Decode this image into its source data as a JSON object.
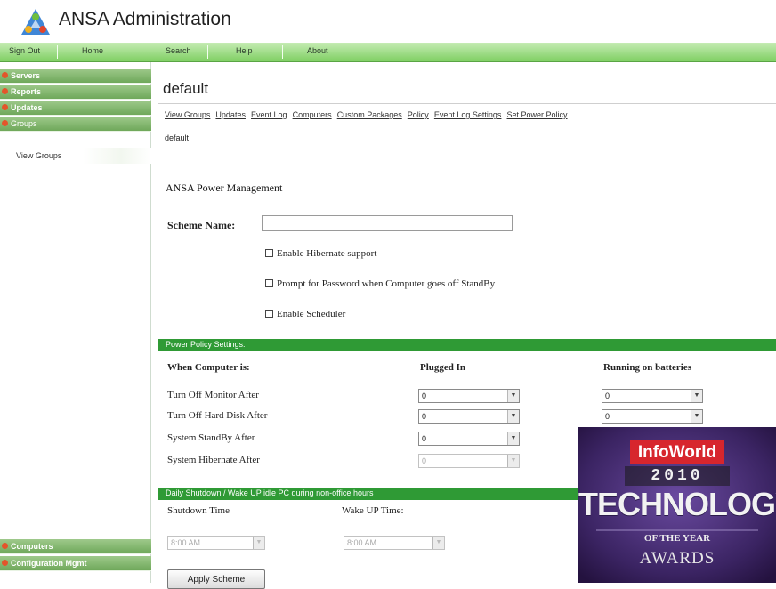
{
  "app": {
    "title": "ANSA Administration"
  },
  "topnav": [
    {
      "label": "Sign Out"
    },
    {
      "label": "Home"
    },
    {
      "label": "Search"
    },
    {
      "label": "Help"
    },
    {
      "label": "About"
    }
  ],
  "sidebar": {
    "items": [
      {
        "label": "Servers"
      },
      {
        "label": "Reports"
      },
      {
        "label": "Updates"
      },
      {
        "label": "Groups"
      }
    ],
    "sub_item": "View Groups",
    "bottom_items": [
      {
        "label": "Computers"
      },
      {
        "label": "Configuration Mgmt"
      }
    ]
  },
  "main": {
    "group_title": "default",
    "tabs": [
      "View Groups",
      "Updates",
      "Event Log",
      "Computers",
      "Custom Packages",
      "Policy",
      "Event Log Settings",
      "Set Power Policy"
    ],
    "breadcrumb": "default",
    "section_title": "ANSA Power Management",
    "scheme_name_label": "Scheme Name:",
    "scheme_name_value": "",
    "checkboxes": [
      {
        "label": "Enable Hibernate support",
        "checked": false
      },
      {
        "label": "Prompt for Password when Computer goes off StandBy",
        "checked": false
      },
      {
        "label": "Enable Scheduler",
        "checked": false
      }
    ],
    "power_policy_header": "Power Policy Settings:",
    "table": {
      "col_when": "When Computer is:",
      "col_plugged": "Plugged In",
      "col_battery": "Running on batteries",
      "rows": [
        {
          "label": "Turn Off Monitor After",
          "plugged": "0",
          "battery": "0",
          "plugged_disabled": false,
          "battery_disabled": false
        },
        {
          "label": "Turn Off Hard Disk After",
          "plugged": "0",
          "battery": "0",
          "plugged_disabled": false,
          "battery_disabled": false
        },
        {
          "label": "System StandBy After",
          "plugged": "0",
          "plugged_disabled": false
        },
        {
          "label": "System Hibernate After",
          "plugged": "0",
          "plugged_disabled": true
        }
      ]
    },
    "shutdown_header": "Daily Shutdown / Wake UP idle PC during non-office hours",
    "shutdown_time_label": "Shutdown Time",
    "wake_time_label": "Wake UP Time:",
    "shutdown_time_value": "8:00 AM",
    "wake_time_value": "8:00 AM",
    "apply_label": "Apply Scheme"
  },
  "award": {
    "brand": "InfoWorld",
    "year": "2010",
    "headline": "TECHNOLOGY",
    "of_the_year": "OF THE YEAR",
    "awards": "AWARDS"
  },
  "colors": {
    "nav_green": "#7fcf63",
    "sidebar_green": "#6fa85a",
    "section_green": "#2f9a35",
    "award_purple": "#3b2463"
  }
}
